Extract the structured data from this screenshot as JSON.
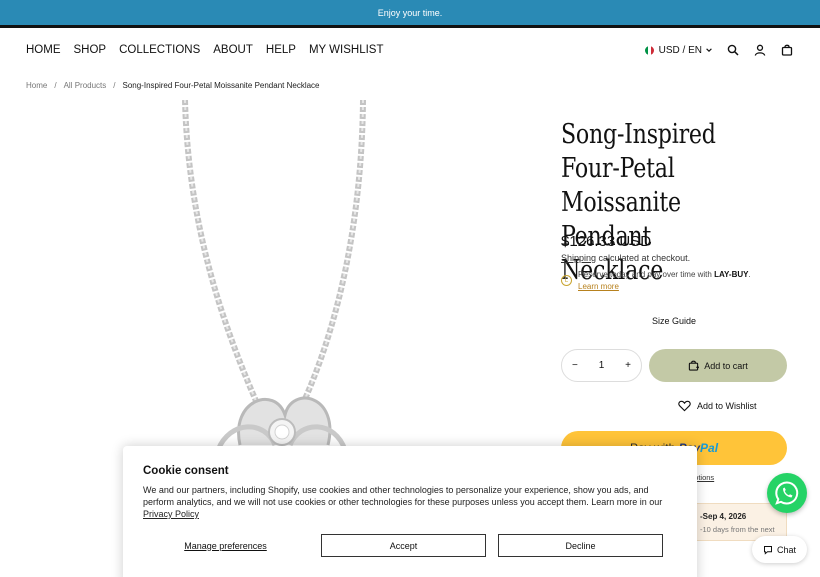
{
  "announcement": "Enjoy your time.",
  "nav": {
    "links": [
      "HOME",
      "SHOP",
      "COLLECTIONS",
      "ABOUT",
      "HELP",
      "MY WISHLIST"
    ],
    "locale": "USD / EN"
  },
  "breadcrumb": [
    "Home",
    "All Products",
    "Song-Inspired Four-Petal Moissanite Pendant Necklace"
  ],
  "product": {
    "title": "Song-Inspired Four-Petal Moissanite Pendant Necklace",
    "price": "$126.33 USD",
    "shipping_link": "Shipping",
    "shipping_rest": " calculated at checkout.",
    "laybuy_text": "Reserve today and pay over time with ",
    "laybuy_brand": "LAY-BUY",
    "laybuy_end": ".",
    "laybuy_learn": "Learn more",
    "size_guide": "Size Guide",
    "quantity": "1",
    "qty_minus": "−",
    "qty_plus": "+",
    "add_to_cart": "Add to cart",
    "add_to_wishlist": "Add to Wishlist",
    "paypal_prefix": "Pay with",
    "paypal_brand_1": "Pay",
    "paypal_brand_2": "Pal",
    "more_options": "options",
    "delivery_date": "-Sep 4, 2026",
    "delivery_note": "-10 days from the next"
  },
  "chat": {
    "label": "Chat"
  },
  "cookie": {
    "title": "Cookie consent",
    "body": "We and our partners, including Shopify, use cookies and other technologies to personalize your experience, show you ads, and perform analytics, and we will not use cookies or other technologies for these purposes unless you accept them. Learn more in our ",
    "policy_link": "Privacy Policy",
    "manage": "Manage preferences",
    "accept": "Accept",
    "decline": "Decline"
  },
  "colors": {
    "announcement_bg": "#2a8ab5",
    "add_to_cart_bg": "#c3c9a6",
    "paypal_bg": "#ffc439",
    "whatsapp": "#25d366"
  }
}
